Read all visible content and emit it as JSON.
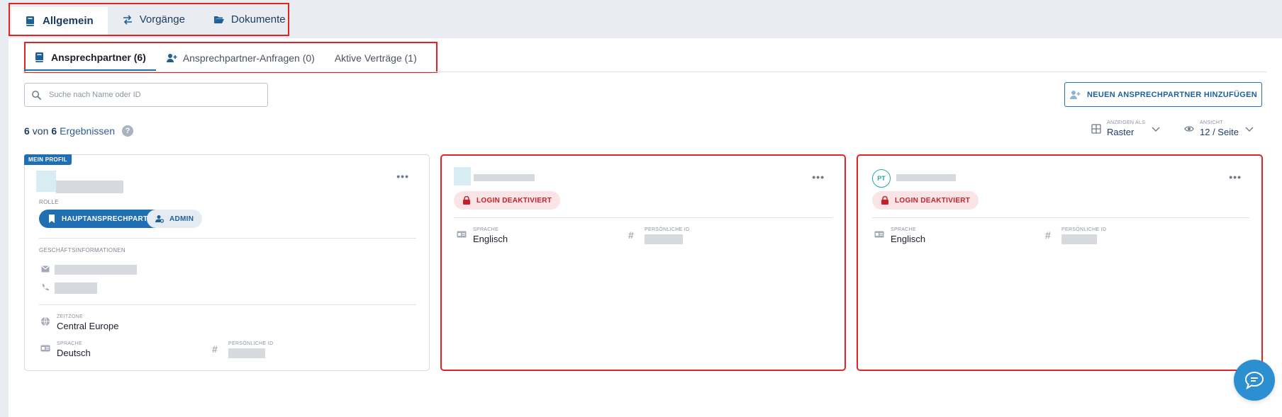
{
  "top_tabs": [
    {
      "label": "Allgemein",
      "icon": "book-icon"
    },
    {
      "label": "Vorgänge",
      "icon": "transfer-arrows-icon"
    },
    {
      "label": "Dokumente",
      "icon": "folder-open-icon"
    }
  ],
  "sub_tabs": [
    {
      "label": "Ansprechpartner (6)",
      "icon": "book-icon"
    },
    {
      "label": "Ansprechpartner-Anfragen (0)",
      "icon": "user-plus-icon"
    },
    {
      "label": "Aktive Verträge (1)"
    }
  ],
  "search": {
    "placeholder": "Suche nach Name oder ID"
  },
  "add_button": {
    "label": "NEUEN ANSPRECHPARTNER HINZUFÜGEN"
  },
  "results": {
    "shown": "6",
    "von": "von",
    "total": "6",
    "label": "Ergebnissen",
    "help": "?"
  },
  "display_as": {
    "label": "ANZEIGEN ALS",
    "value": "Raster"
  },
  "view": {
    "label": "ANSICHT",
    "value": "12 / Seite"
  },
  "cards": [
    {
      "badge": "MEIN PROFIL",
      "more": "•••",
      "role_label": "ROLLE",
      "role_primary": "HAUPTANSPRECHPARTNER",
      "role_secondary": "ADMIN",
      "business_label": "GESCHÄFTSINFORMATIONEN",
      "timezone_label": "ZEITZONE",
      "timezone": "Central Europe",
      "language_label": "SPRACHE",
      "language": "Deutsch",
      "personal_id_label": "PERSÖNLICHE ID"
    },
    {
      "more": "•••",
      "status": "LOGIN DEAKTIVIERT",
      "language_label": "SPRACHE",
      "language": "Englisch",
      "personal_id_label": "PERSÖNLICHE ID"
    },
    {
      "initials": "PT",
      "more": "•••",
      "status": "LOGIN DEAKTIVIERT",
      "language_label": "SPRACHE",
      "language": "Englisch",
      "personal_id_label": "PERSÖNLICHE ID"
    }
  ],
  "colors": {
    "accent": "#1f6fb2",
    "danger": "#c8202a",
    "highlight_border": "#e02424",
    "teal": "#23a7a7"
  }
}
